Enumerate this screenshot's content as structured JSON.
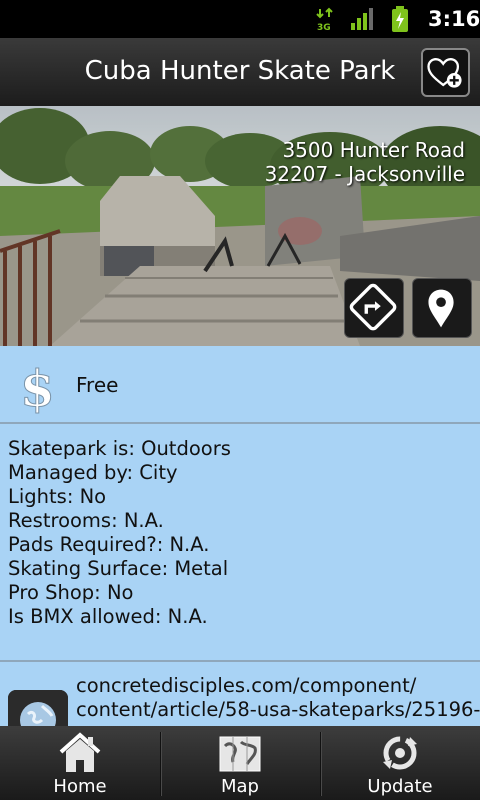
{
  "status_bar": {
    "network": "3G",
    "time": "3:16",
    "icons": [
      "network-3g-icon",
      "signal-icon",
      "battery-charging-icon"
    ]
  },
  "header": {
    "title": "Cuba Hunter Skate Park",
    "favorite_icon": "heart-plus-icon"
  },
  "location": {
    "street": "3500 Hunter Road",
    "city_line": "32207 - Jacksonville",
    "buttons": [
      "directions-icon",
      "map-pin-icon"
    ]
  },
  "price": {
    "icon": "dollar-icon",
    "label": "Free"
  },
  "details": [
    "Skatepark is: Outdoors",
    "Managed by: City",
    "Lights: No",
    "Restrooms: N.A.",
    "Pads Required?: N.A.",
    "Skating Surface: Metal",
    "Pro Shop: No",
    "Is BMX allowed: N.A."
  ],
  "link": {
    "icon": "globe-icon",
    "line1": "concretedisciples.com/component/",
    "line2": "content/article/58-usa-skateparks/25196-"
  },
  "bottom_nav": [
    {
      "label": "Home",
      "icon": "home-icon"
    },
    {
      "label": "Map",
      "icon": "map-icon"
    },
    {
      "label": "Update",
      "icon": "update-icon"
    }
  ],
  "colors": {
    "content_background": "#a9d3f5",
    "bar_dark": "#1c1c1c",
    "battery_green": "#7fc31c"
  }
}
